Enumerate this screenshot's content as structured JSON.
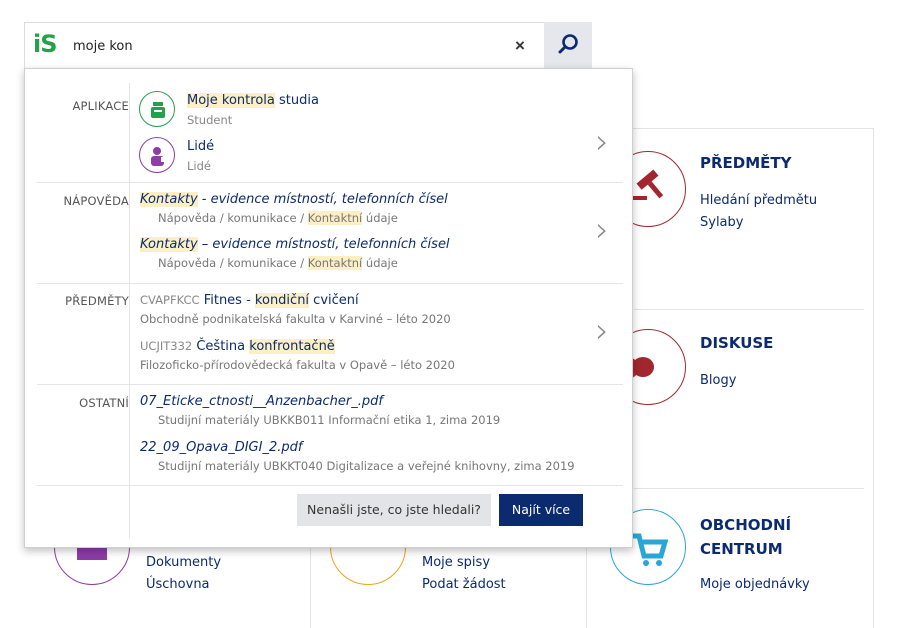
{
  "logo": "iS",
  "search": {
    "value": "moje kon",
    "clear_label": "×"
  },
  "tiles": {
    "predmety": {
      "title": "PŘEDMĚTY",
      "links": [
        "Hledání předmětu",
        "Sylaby"
      ]
    },
    "diskuse": {
      "title": "DISKUSE",
      "links": [
        "Blogy"
      ]
    },
    "obchodni": {
      "title": "OBCHODNÍ CENTRUM",
      "title_line1": "OBCHODNÍ",
      "title_line2": "CENTRUM",
      "links": [
        "Moje objednávky"
      ]
    },
    "dokumenty": {
      "links": [
        "Dokumenty",
        "Úschovna"
      ]
    },
    "spisy": {
      "links": [
        "Moje spisy",
        "Podat žádost"
      ]
    }
  },
  "dropdown": {
    "aplikace": {
      "label": "APLIKACE",
      "items": [
        {
          "title_hl": "Moje kontrola",
          "title_rest": " studia",
          "sub": "Student"
        },
        {
          "title": "Lidé",
          "sub": "Lidé"
        }
      ]
    },
    "napoveda": {
      "label": "NÁPOVĚDA",
      "items": [
        {
          "title_hl": "Kontakty",
          "title_rest": " - evidence místností, telefonních čísel",
          "meta_pre": "Nápověda / komunikace / ",
          "meta_hl": "Kontaktní",
          "meta_post": " údaje"
        },
        {
          "title_hl": "Kontakty",
          "title_rest": " – evidence místností, telefonních čísel",
          "meta_pre": "Nápověda / komunikace / ",
          "meta_hl": "Kontaktní",
          "meta_post": " údaje"
        }
      ]
    },
    "predmety": {
      "label": "PŘEDMĚTY",
      "items": [
        {
          "code": "CVAPFKCC",
          "t1": "Fitnes - ",
          "hl": "kondiční",
          "t2": " cvičení",
          "meta": "Obchodně podnikatelská fakulta v Karviné – léto 2020"
        },
        {
          "code": "UCJIT332",
          "t1": "Čeština ",
          "hl": "konfrontačně",
          "t2": "",
          "meta": "Filozoficko-přírodovědecká fakulta v Opavě – léto 2020"
        }
      ]
    },
    "ostatni": {
      "label": "OSTATNÍ",
      "items": [
        {
          "title": "07_Eticke_ctnosti__Anzenbacher_.pdf",
          "meta": "Studijní materiály UBKKB011 Informační etika 1, zima 2019"
        },
        {
          "title": "22_09_Opava_DIGI_2.pdf",
          "meta": "Studijní materiály UBKKT040 Digitalizace a veřejné knihovny, zima 2019"
        }
      ]
    },
    "not_found_label": "Nenašli jste, co jste hledali?",
    "find_more_label": "Najít více"
  },
  "colors": {
    "navy": "#0b2a6f",
    "green": "#25a14b",
    "purple": "#8e3ca6",
    "red": "#a3262e",
    "orange": "#f0a21c",
    "cyan": "#29a6d8",
    "highlight": "#fcefc4"
  },
  "icons": [
    "search-icon",
    "close-icon",
    "chevron-right-icon",
    "student-icon",
    "person-icon",
    "gavel-icon",
    "speech-bubbles-icon",
    "cart-icon",
    "folder-icon",
    "stamp-icon"
  ]
}
